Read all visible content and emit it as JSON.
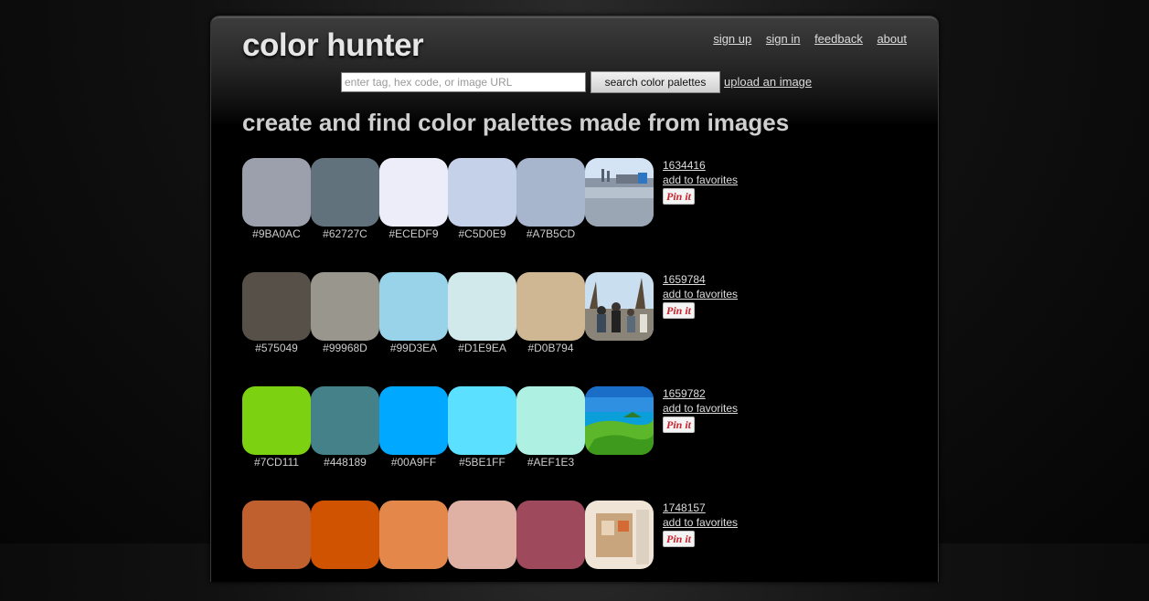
{
  "logo": "color hunter",
  "nav": [
    "sign up",
    "sign in",
    "feedback",
    "about"
  ],
  "search": {
    "placeholder": "enter tag, hex code, or image URL",
    "value": "",
    "button_label": "search color palettes",
    "upload_label": "upload an image"
  },
  "headline": "create and find color palettes made from images",
  "palettes": [
    {
      "id": "1634416",
      "favorite_label": "add to favorites",
      "pin_label": "Pin it",
      "thumb_icon": "industrial-waterfront-photo",
      "colors": [
        "#9BA0AC",
        "#62727C",
        "#ECEDF9",
        "#C5D0E9",
        "#A7B5CD"
      ]
    },
    {
      "id": "1659784",
      "favorite_label": "add to favorites",
      "pin_label": "Pin it",
      "thumb_icon": "crowd-park-photo",
      "colors": [
        "#575049",
        "#99968D",
        "#99D3EA",
        "#D1E9EA",
        "#D0B794"
      ]
    },
    {
      "id": "1659782",
      "favorite_label": "add to favorites",
      "pin_label": "Pin it",
      "thumb_icon": "coastal-cliffs-photo",
      "colors": [
        "#7CD111",
        "#448189",
        "#00A9FF",
        "#5BE1FF",
        "#AEF1E3"
      ]
    },
    {
      "id": "1748157",
      "favorite_label": "add to favorites",
      "pin_label": "Pin it",
      "thumb_icon": "room-interior-photo",
      "colors": [
        "#C0602F",
        "#CF5300",
        "#E3884A",
        "#DFB1A4",
        "#9E4A5C"
      ]
    }
  ]
}
